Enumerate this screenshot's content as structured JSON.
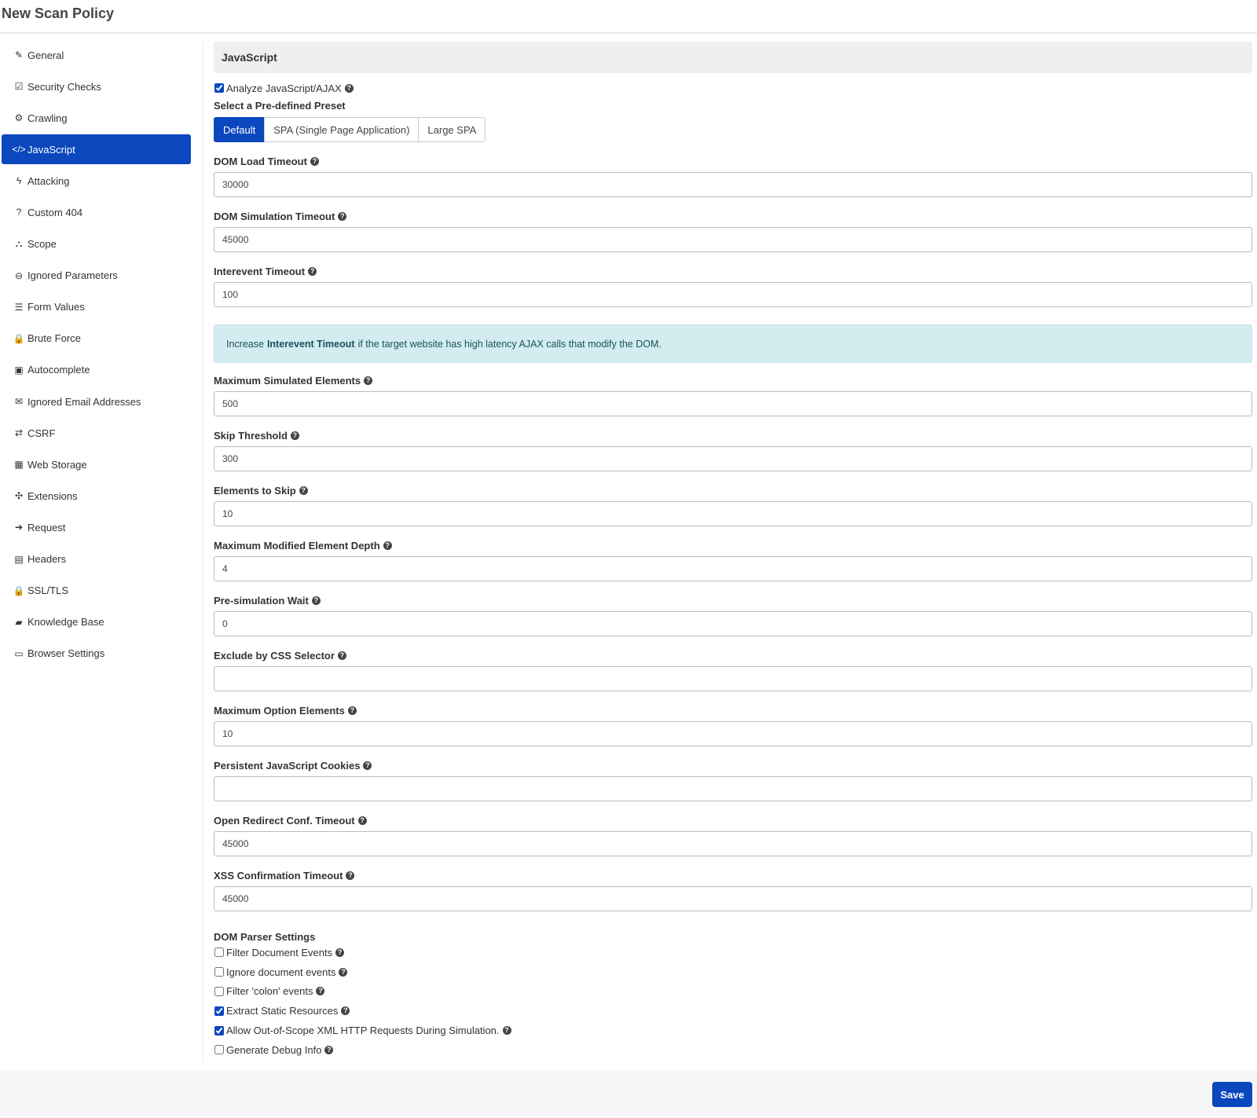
{
  "page_title": "New Scan Policy",
  "sidebar": {
    "items": [
      {
        "label": "General",
        "icon": "✎",
        "name": "edit"
      },
      {
        "label": "Security Checks",
        "icon": "☑",
        "name": "check-square"
      },
      {
        "label": "Crawling",
        "icon": "⚙",
        "name": "cogs"
      },
      {
        "label": "JavaScript",
        "icon": "</>",
        "name": "code",
        "active": true
      },
      {
        "label": "Attacking",
        "icon": "ϟ",
        "name": "bolt"
      },
      {
        "label": "Custom 404",
        "icon": "?",
        "name": "question-circle"
      },
      {
        "label": "Scope",
        "icon": "⛬",
        "name": "sitemap"
      },
      {
        "label": "Ignored Parameters",
        "icon": "⊖",
        "name": "minus-circle"
      },
      {
        "label": "Form Values",
        "icon": "☰",
        "name": "list"
      },
      {
        "label": "Brute Force",
        "icon": "🔒",
        "name": "lock"
      },
      {
        "label": "Autocomplete",
        "icon": "▣",
        "name": "caret-square"
      },
      {
        "label": "Ignored Email Addresses",
        "icon": "✉",
        "name": "envelope"
      },
      {
        "label": "CSRF",
        "icon": "⇄",
        "name": "exchange"
      },
      {
        "label": "Web Storage",
        "icon": "▦",
        "name": "th"
      },
      {
        "label": "Extensions",
        "icon": "✣",
        "name": "puzzle"
      },
      {
        "label": "Request",
        "icon": "➔",
        "name": "arrow-right"
      },
      {
        "label": "Headers",
        "icon": "▤",
        "name": "file-text"
      },
      {
        "label": "SSL/TLS",
        "icon": "🔒",
        "name": "lock"
      },
      {
        "label": "Knowledge Base",
        "icon": "▰",
        "name": "book"
      },
      {
        "label": "Browser Settings",
        "icon": "▭",
        "name": "window"
      }
    ]
  },
  "section_title": "JavaScript",
  "analyze": {
    "label": "Analyze JavaScript/AJAX",
    "checked": true
  },
  "preset": {
    "label": "Select a Pre-defined Preset",
    "options": [
      "Default",
      "SPA (Single Page Application)",
      "Large SPA"
    ],
    "selected": "Default"
  },
  "fields_a": [
    {
      "label": "DOM Load Timeout",
      "value": "30000"
    },
    {
      "label": "DOM Simulation Timeout",
      "value": "45000"
    },
    {
      "label": "Interevent Timeout",
      "value": "100"
    }
  ],
  "alert": {
    "pre": "Increase",
    "bold": "Interevent Timeout",
    "post": "if the target website has high latency AJAX calls that modify the DOM."
  },
  "fields_b": [
    {
      "label": "Maximum Simulated Elements",
      "value": "500"
    },
    {
      "label": "Skip Threshold",
      "value": "300"
    },
    {
      "label": "Elements to Skip",
      "value": "10"
    },
    {
      "label": "Maximum Modified Element Depth",
      "value": "4"
    },
    {
      "label": "Pre-simulation Wait",
      "value": "0"
    },
    {
      "label": "Exclude by CSS Selector",
      "value": ""
    },
    {
      "label": "Maximum Option Elements",
      "value": "10"
    },
    {
      "label": "Persistent JavaScript Cookies",
      "value": ""
    },
    {
      "label": "Open Redirect Conf. Timeout",
      "value": "45000"
    },
    {
      "label": "XSS Confirmation Timeout",
      "value": "45000"
    }
  ],
  "parser": {
    "label": "DOM Parser Settings",
    "options": [
      {
        "label": "Filter Document Events",
        "checked": false
      },
      {
        "label": "Ignore document events",
        "checked": false
      },
      {
        "label": "Filter 'colon' events",
        "checked": false
      },
      {
        "label": "Extract Static Resources",
        "checked": true
      },
      {
        "label": "Allow Out-of-Scope XML HTTP Requests During Simulation.",
        "checked": true
      },
      {
        "label": "Generate Debug Info",
        "checked": false
      }
    ]
  },
  "save_label": "Save",
  "help_icon": "?"
}
